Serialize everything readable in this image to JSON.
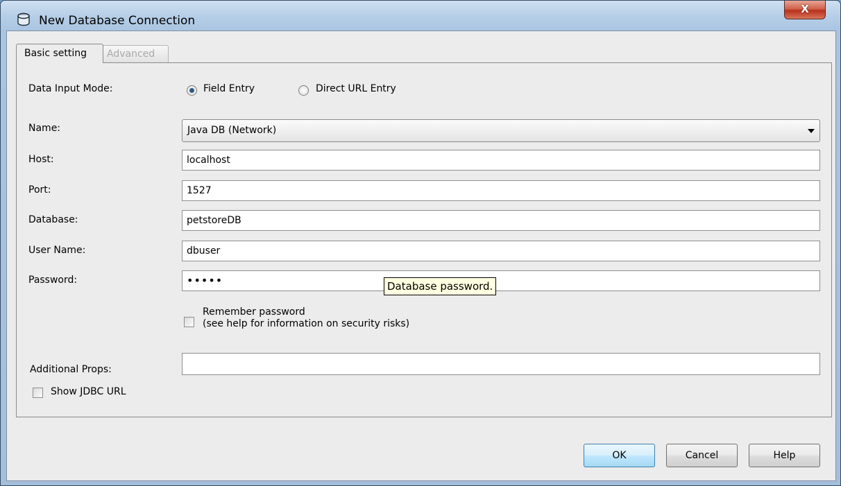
{
  "window": {
    "title": "New Database Connection",
    "close_label": "X"
  },
  "tabs": [
    {
      "label": "Basic setting",
      "active": true
    },
    {
      "label": "Advanced",
      "active": false
    }
  ],
  "form": {
    "input_mode_label": "Data Input Mode:",
    "mode_field": "Field Entry",
    "mode_url": "Direct URL Entry",
    "name_label": "Name:",
    "name_value": "Java DB (Network)",
    "host_label": "Host:",
    "host_value": "localhost",
    "port_label": "Port:",
    "port_value": "1527",
    "database_label": "Database:",
    "database_value": "petstoreDB",
    "username_label": "User Name:",
    "username_value": "dbuser",
    "password_label": "Password:",
    "password_value": "•••••",
    "remember_label": "Remember password",
    "remember_note": "(see help for information on security risks)",
    "props_label": "Additional Props:",
    "props_value": "",
    "show_jdbc_label": "Show JDBC URL"
  },
  "tooltip": "Database password.",
  "buttons": {
    "ok": "OK",
    "cancel": "Cancel",
    "help": "Help"
  }
}
